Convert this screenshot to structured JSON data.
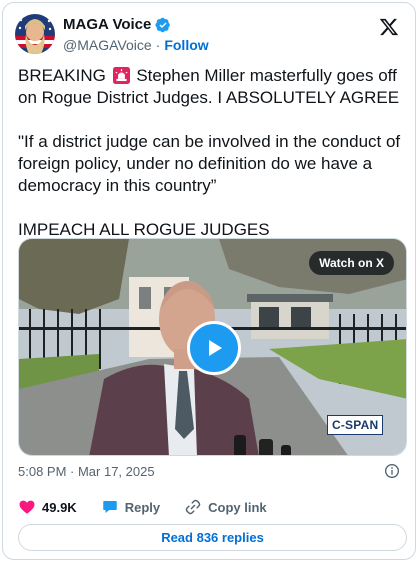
{
  "author": {
    "display_name": "MAGA Voice",
    "handle": "@MAGAVoice",
    "separator": "·",
    "follow_label": "Follow"
  },
  "tweet": {
    "paragraphs": [
      {
        "before_emoji": "BREAKING ",
        "emoji": "siren-icon",
        "after_emoji": " Stephen Miller masterfully goes off on Rogue District Judges. I ABSOLUTELY AGREE"
      },
      {
        "text": "\"If a district judge can be involved in the conduct of foreign policy, under no definition do we have a democracy in this country”"
      },
      {
        "text": "IMPEACH ALL ROGUE JUDGES"
      }
    ]
  },
  "media": {
    "watch_label": "Watch on X",
    "network_logo": "C-SPAN",
    "play_icon": "play-icon"
  },
  "meta": {
    "timestamp": "5:08 PM · Mar 17, 2025",
    "info_icon": "info-icon"
  },
  "actions": {
    "likes_count": "49.9K",
    "reply_label": "Reply",
    "copy_link_label": "Copy link",
    "read_replies_label": "Read 836 replies"
  },
  "colors": {
    "accent": "#1d9bf0",
    "link": "#006fd6",
    "like": "#f91880",
    "text": "#0f1419",
    "muted": "#536471",
    "border": "#cfd9de"
  }
}
